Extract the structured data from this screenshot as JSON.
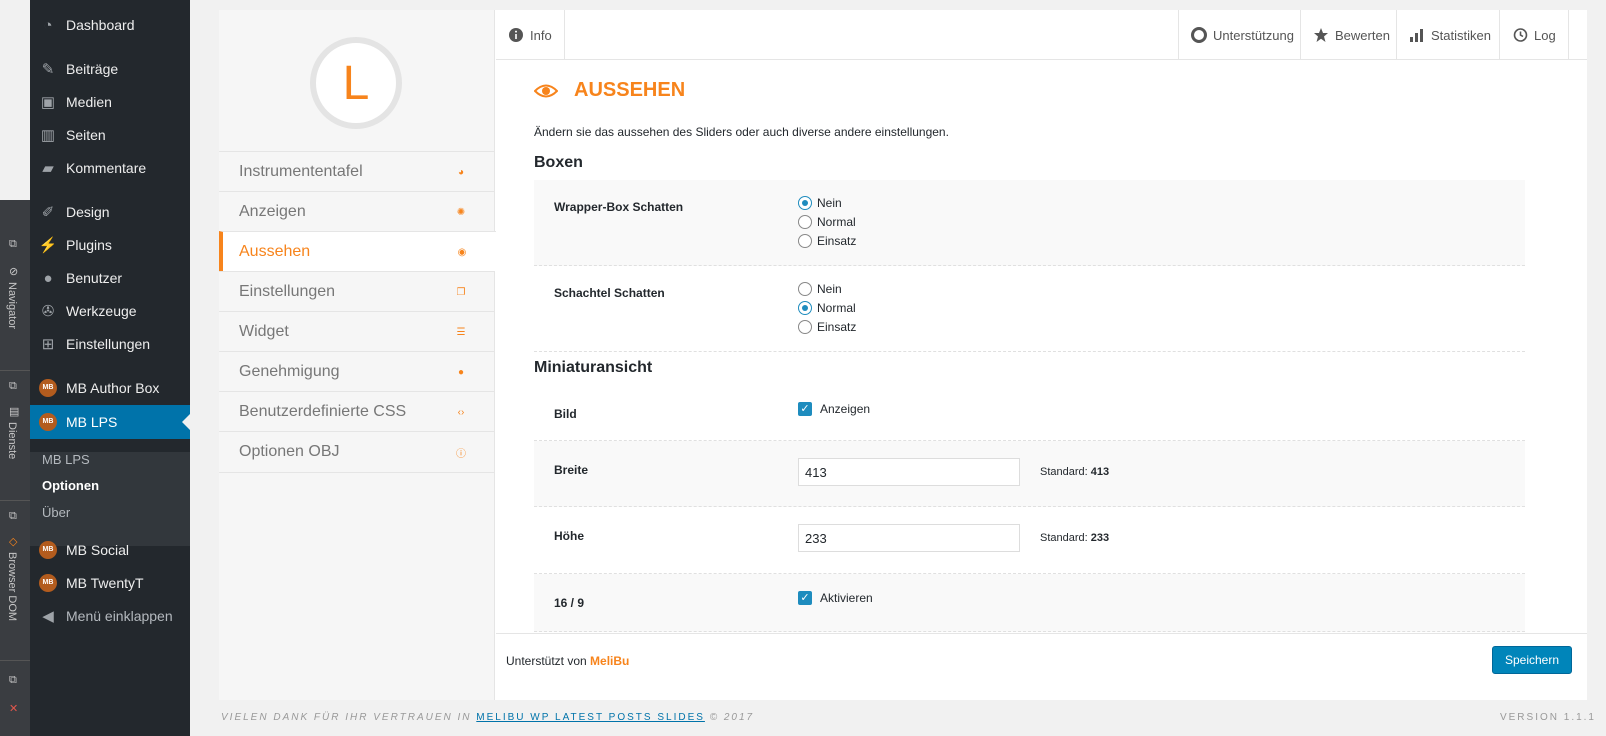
{
  "devtools": {
    "navigator_label": "Navigator",
    "dienste_label": "Dienste",
    "dom_label": "Browser DOM"
  },
  "menu": {
    "items": [
      {
        "label": "Dashboard",
        "icon": "dashboard-icon"
      },
      {
        "label": "Beiträge",
        "icon": "pin-icon"
      },
      {
        "label": "Medien",
        "icon": "media-icon"
      },
      {
        "label": "Seiten",
        "icon": "pages-icon"
      },
      {
        "label": "Kommentare",
        "icon": "comments-icon"
      },
      {
        "label": "Design",
        "icon": "brush-icon"
      },
      {
        "label": "Plugins",
        "icon": "plugin-icon"
      },
      {
        "label": "Benutzer",
        "icon": "user-icon"
      },
      {
        "label": "Werkzeuge",
        "icon": "wrench-icon"
      },
      {
        "label": "Einstellungen",
        "icon": "settings-icon"
      },
      {
        "label": "MB Author Box",
        "icon": "mb-icon"
      },
      {
        "label": "MB LPS",
        "icon": "mb-icon"
      },
      {
        "label": "MB Social",
        "icon": "mb-icon"
      },
      {
        "label": "MB TwentyT",
        "icon": "mb-icon"
      },
      {
        "label": "Menü einklappen",
        "icon": "collapse-icon"
      }
    ],
    "mb_badge": "MB",
    "submenu": [
      "MB LPS",
      "Optionen",
      "Über"
    ]
  },
  "plugin": {
    "logo_letter": "L",
    "nav": [
      {
        "label": "Instrumententafel",
        "icon": "gauge-icon"
      },
      {
        "label": "Anzeigen",
        "icon": "gear-icon"
      },
      {
        "label": "Aussehen",
        "icon": "eye-icon"
      },
      {
        "label": "Einstellungen",
        "icon": "copy-icon"
      },
      {
        "label": "Widget",
        "icon": "widget-icon"
      },
      {
        "label": "Genehmigung",
        "icon": "user-icon"
      },
      {
        "label": "Benutzerdefinierte CSS",
        "icon": "code-icon"
      },
      {
        "label": "Optionen OBJ",
        "icon": "info-icon"
      }
    ],
    "tabs": {
      "info": "Info",
      "support": "Unterstützung",
      "rate": "Bewerten",
      "stats": "Statistiken",
      "log": "Log"
    }
  },
  "content": {
    "title": "AUSSEHEN",
    "description": "Ändern sie das aussehen des Sliders oder auch diverse andere einstellungen.",
    "group_boxen": "Boxen",
    "wrapper_label": "Wrapper-Box Schatten",
    "schachtel_label": "Schachtel Schatten",
    "opt_nein": "Nein",
    "opt_normal": "Normal",
    "opt_einsatz": "Einsatz",
    "group_mini": "Miniaturansicht",
    "bild_label": "Bild",
    "bild_check": "Anzeigen",
    "breite_label": "Breite",
    "breite_value": "413",
    "breite_std_label": "Standard:",
    "breite_std": "413",
    "hoehe_label": "Höhe",
    "hoehe_value": "233",
    "hoehe_std_label": "Standard:",
    "hoehe_std": "233",
    "ratio_label": "16 / 9",
    "ratio_check": "Aktivieren"
  },
  "footer": {
    "powered_prefix": "Unterstützt von",
    "powered_brand": "MeliBu",
    "save": "Speichern",
    "thanks_prefix": "VIELEN DANK FÜR IHR VERTRAUEN IN",
    "thanks_link": "MELIBU WP LATEST POSTS SLIDES",
    "thanks_suffix": "© 2017",
    "version": "VERSION 1.1.1"
  },
  "colors": {
    "accent": "#f7841c",
    "wp_blue": "#0073aa",
    "menu_bg": "#23282d"
  }
}
